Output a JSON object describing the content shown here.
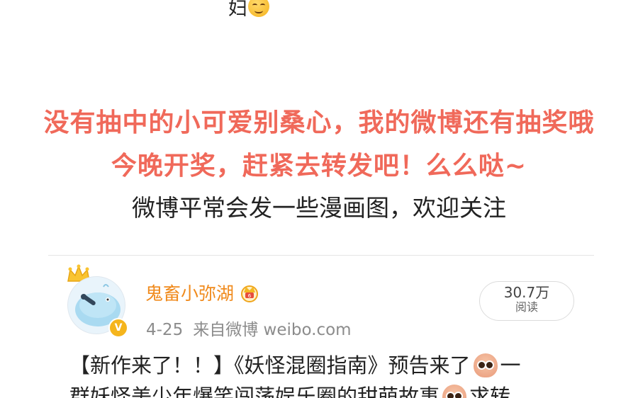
{
  "top_fragment": {
    "text": "妇",
    "emoji": "smirk-emoji"
  },
  "promo": {
    "line1": "没有抽中的小可爱别桑心，我的微博还有抽奖哦",
    "line2": "今晚开奖，赶紧去转发吧！么么哒~",
    "color": "#f0695a"
  },
  "note": "微博平常会发一些漫画图，欢迎关注",
  "card": {
    "username": "鬼畜小弥湖",
    "username_color": "#f08a1c",
    "date": "4-25",
    "source": "来自微博 weibo.com",
    "reads_count": "30.7万",
    "reads_label": "阅读",
    "verified_badge": "V",
    "post_line1_a": "【新作来了！！】《妖怪混圈指南》预告来了",
    "post_line1_b": "一",
    "post_line2_a": "群妖怪美少年爆笑闯荡娱乐圈的甜萌故事",
    "post_line2_b": "求转"
  }
}
